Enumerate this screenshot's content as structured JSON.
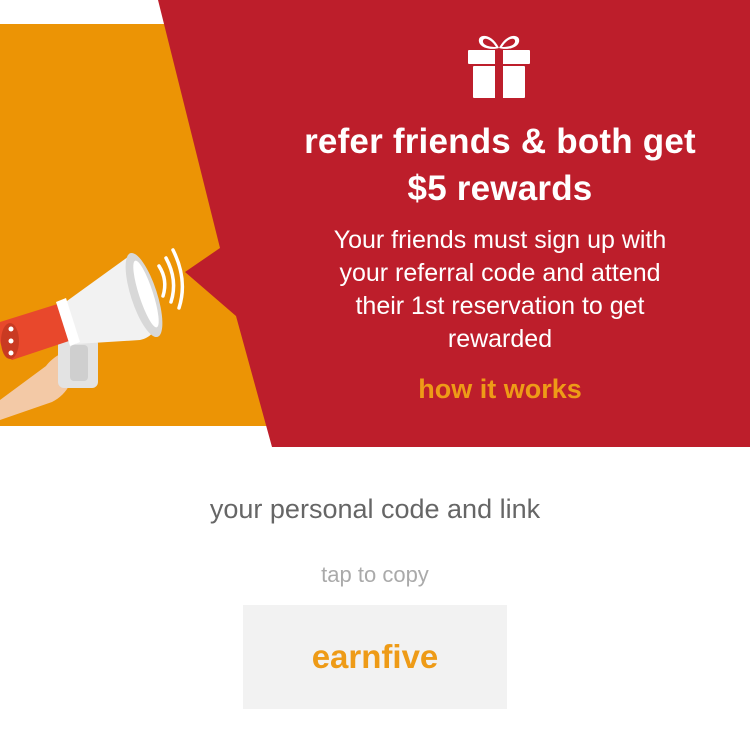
{
  "colors": {
    "banner_red": "#bd1e2b",
    "banner_orange": "#ec9405",
    "accent_orange": "#ee9b17",
    "text_gray": "#666666",
    "hint_gray": "#aaaaaa",
    "code_box_bg": "#f2f2f2"
  },
  "banner": {
    "headline_line1": "refer friends & both get",
    "headline_line2": "$5 rewards",
    "description_lines": [
      "Your friends must sign up with",
      "your referral code and attend",
      "their 1st reservation to get",
      "rewarded"
    ],
    "how_it_works_label": "how it works",
    "icons": [
      "gift-icon",
      "megaphone-icon",
      "sound-waves-icon"
    ]
  },
  "referral": {
    "title": "your personal code and link",
    "copy_hint": "tap to copy",
    "code": "earnfive"
  }
}
